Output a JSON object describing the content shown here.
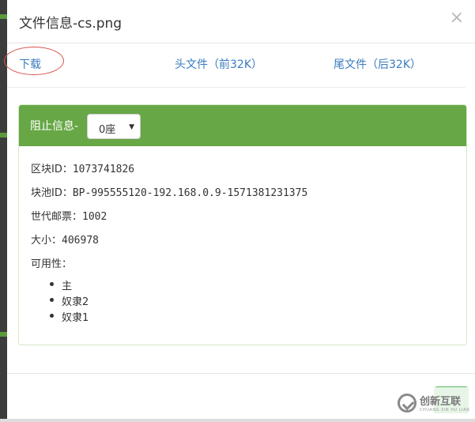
{
  "dialog": {
    "title": "文件信息-cs.png",
    "close_glyph": "×"
  },
  "links": {
    "download": "下载",
    "head_file": "头文件（前32K）",
    "tail_file": "尾文件（后32K）"
  },
  "panel": {
    "heading_label": "阻止信息-",
    "select_value": "0座",
    "rows": [
      {
        "label": "区块ID：",
        "value": "1073741826"
      },
      {
        "label": "块池ID：",
        "value": "BP-995555120-192.168.0.9-1571381231375"
      },
      {
        "label": "世代邮票：",
        "value": "1002"
      },
      {
        "label": "大小：",
        "value": "406978"
      }
    ],
    "availability_label": "可用性：",
    "availability": [
      "主",
      "奴隶2",
      "奴隶1"
    ]
  },
  "watermark": {
    "text": "创新互联",
    "sub": "CHUANG XIN HU LIAN"
  },
  "colors": {
    "panel_heading": "#67a746",
    "link": "#3a7bbf",
    "annotation": "#d9534f"
  }
}
